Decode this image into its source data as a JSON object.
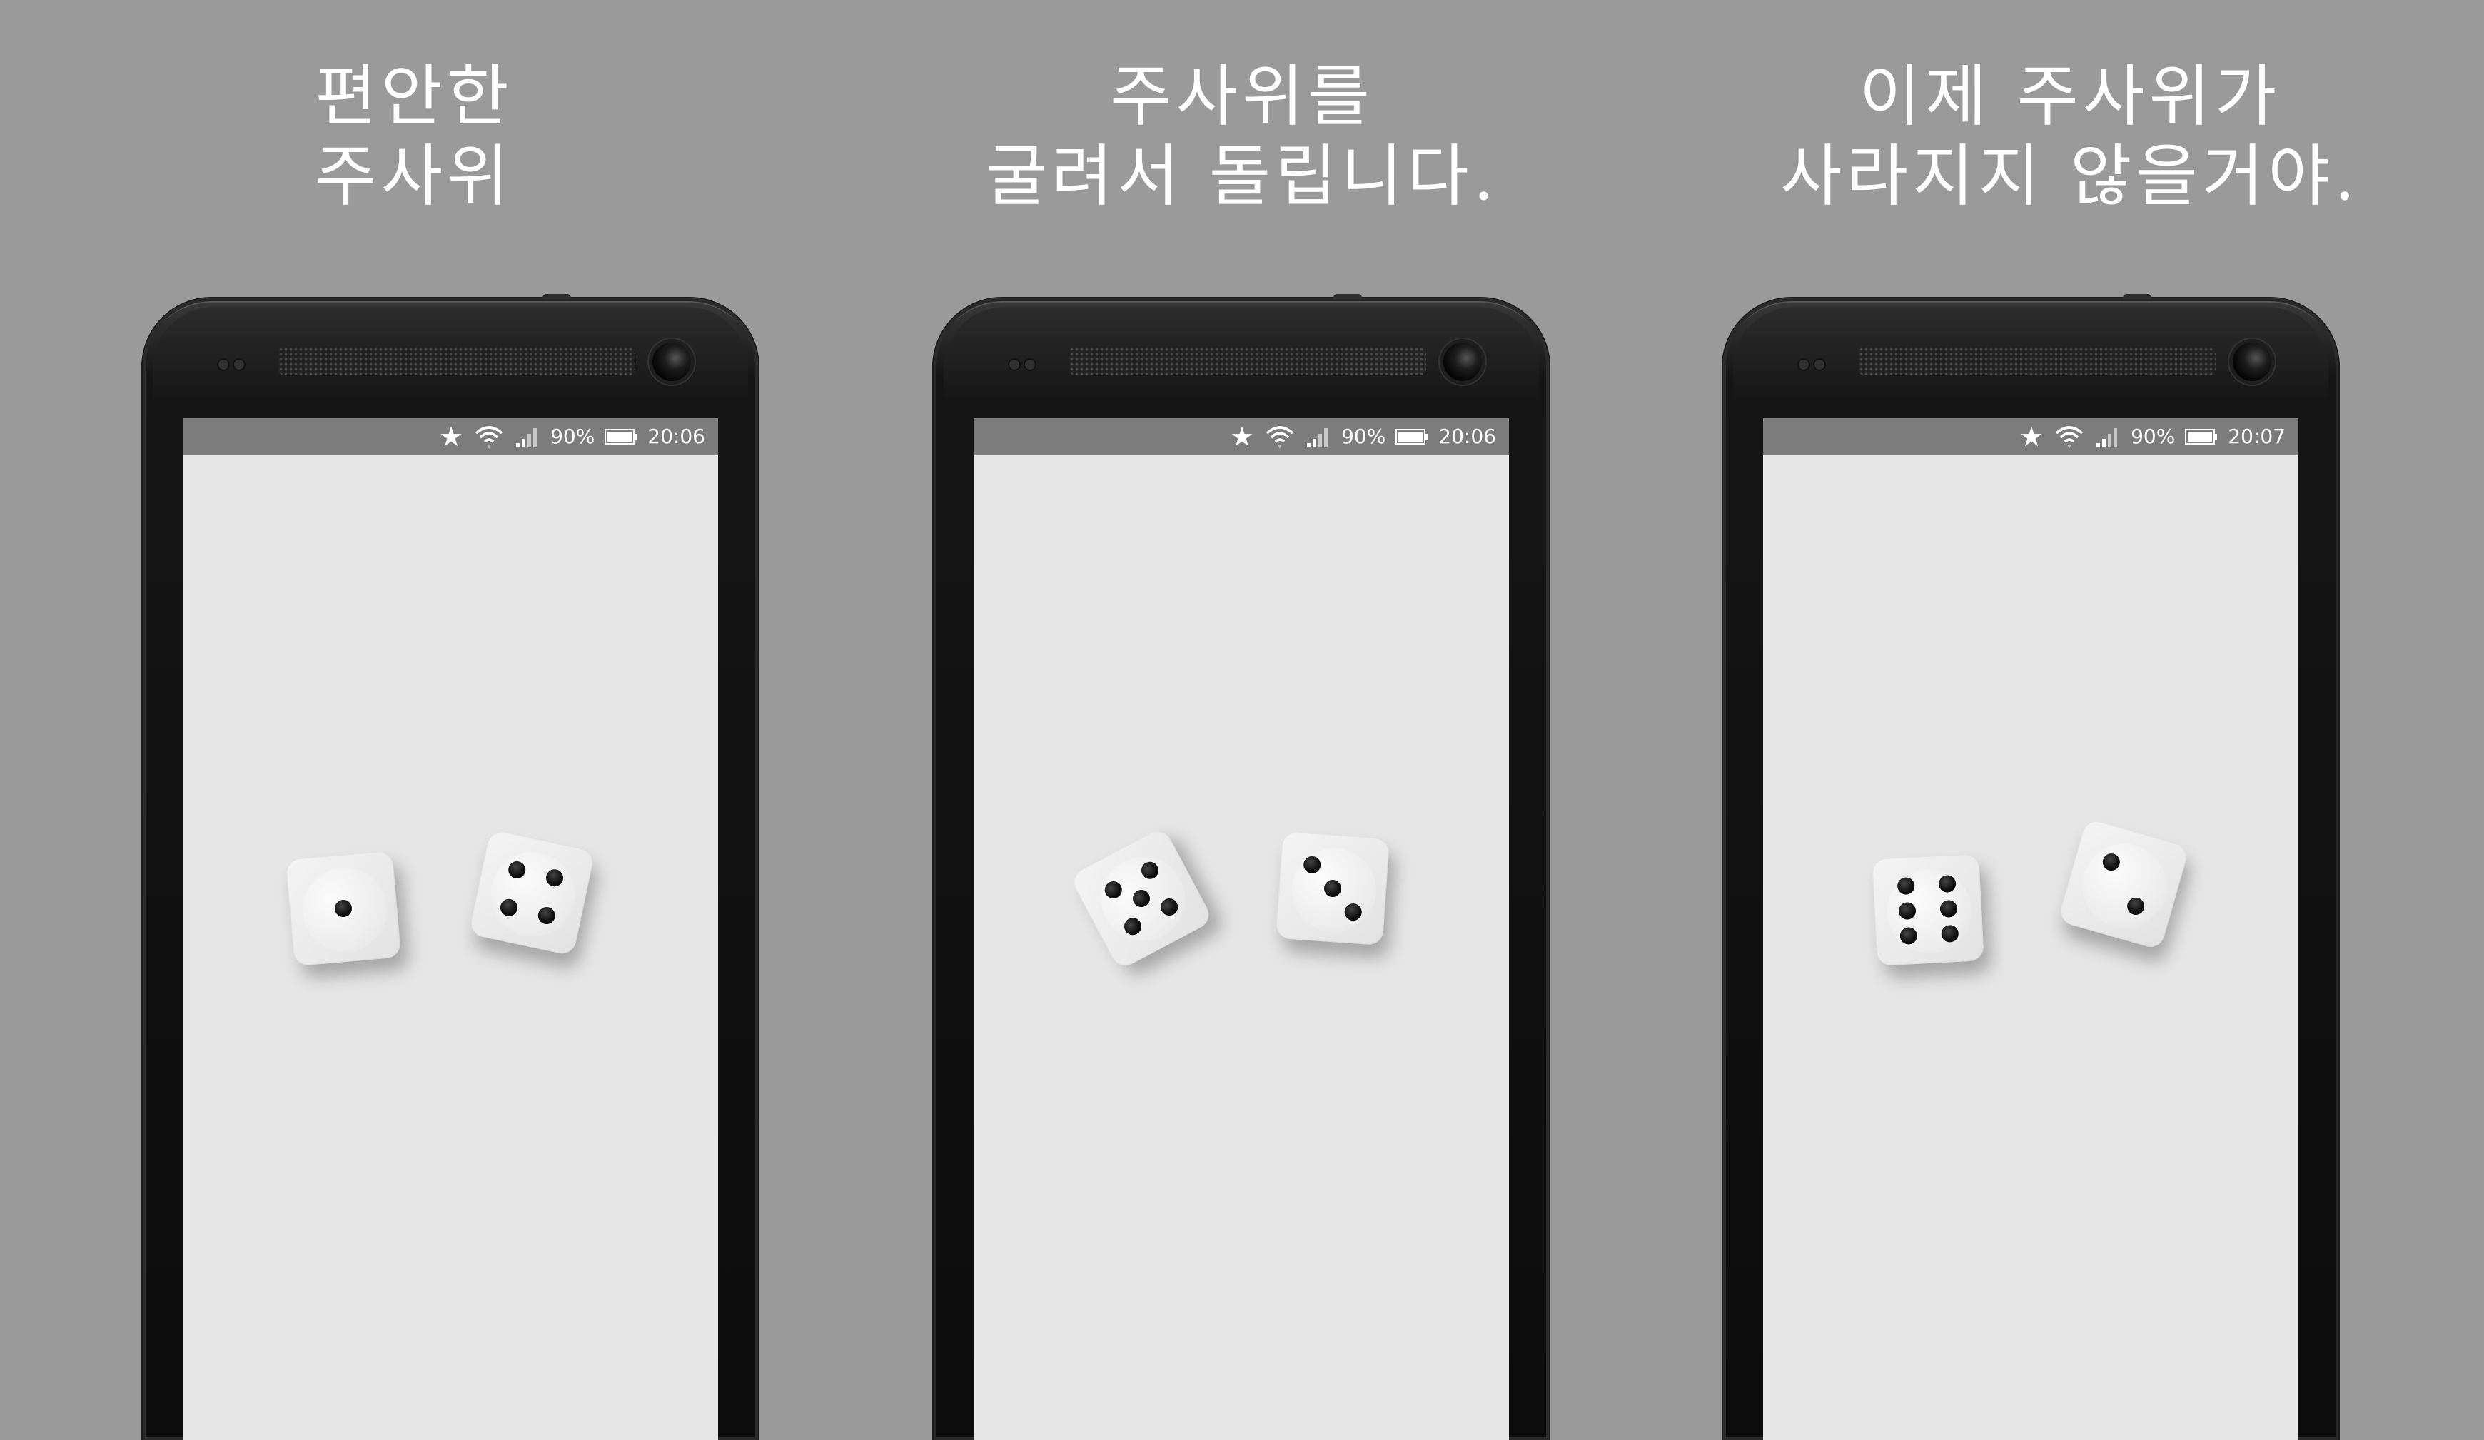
{
  "panels": [
    {
      "caption": [
        "편안한",
        "주사위"
      ],
      "status": {
        "battery_pct": "90%",
        "time": "20:06"
      },
      "dice": [
        {
          "value": 1
        },
        {
          "value": 4
        }
      ]
    },
    {
      "caption": [
        "주사위를",
        "굴려서 돌립니다."
      ],
      "status": {
        "battery_pct": "90%",
        "time": "20:06"
      },
      "dice": [
        {
          "value": 5
        },
        {
          "value": 3
        }
      ]
    },
    {
      "caption": [
        "이제 주사위가",
        "사라지지 않을거야."
      ],
      "status": {
        "battery_pct": "90%",
        "time": "20:07"
      },
      "dice": [
        {
          "value": 6
        },
        {
          "value": 2
        }
      ]
    }
  ],
  "icons": {
    "status_icons": [
      "star-icon",
      "wifi-icon",
      "signal-icon",
      "battery-icon"
    ]
  },
  "colors": {
    "background": "#9a9a9a",
    "screen": "#e6e6e6",
    "status_bar": "#7c7c7c",
    "caption_text": "#ffffff",
    "pip": "#111111"
  }
}
